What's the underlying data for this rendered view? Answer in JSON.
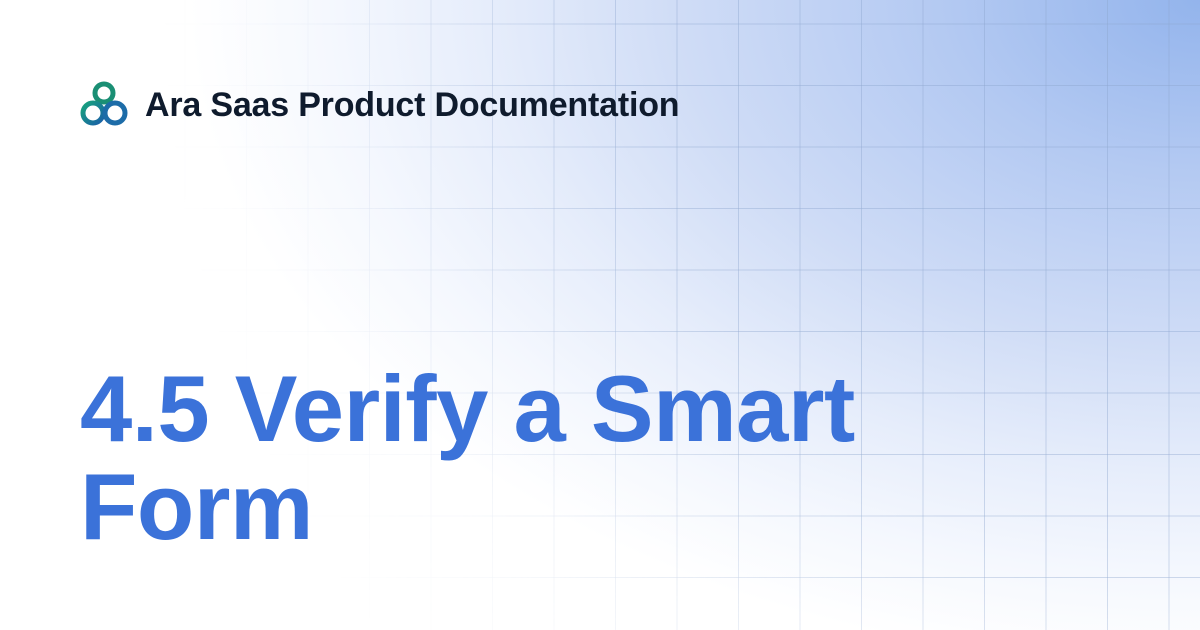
{
  "brand": {
    "name": "Ara Saas Product Documentation",
    "logo_icon": "linked-loops-logo-icon",
    "logo_colors": [
      "#17a37c",
      "#1a5fa8"
    ]
  },
  "page": {
    "title": "4.5 Verify a Smart Form",
    "accent_color": "#3b72d9"
  }
}
